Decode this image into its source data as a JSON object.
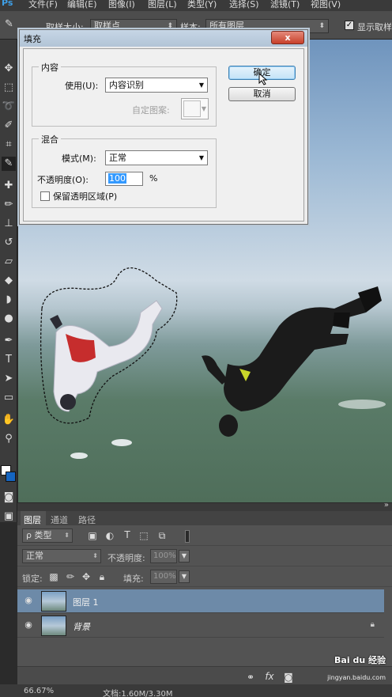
{
  "menu": [
    "文件(F)",
    "编辑(E)",
    "图像(I)",
    "图层(L)",
    "类型(Y)",
    "选择(S)",
    "滤镜(T)",
    "视图(V)"
  ],
  "options_bar": {
    "sample_size_label": "取样大小:",
    "sample_size_value": "取样点",
    "sample_label": "样本:",
    "sample_value": "所有图层",
    "show_ring_label": "显示取样"
  },
  "dialog": {
    "title": "填充",
    "close_label": "x",
    "content_group": "内容",
    "use_label": "使用(U):",
    "use_value": "内容识别",
    "custom_pattern_label": "自定图案:",
    "blend_group": "混合",
    "mode_label": "模式(M):",
    "mode_value": "正常",
    "opacity_label": "不透明度(O):",
    "opacity_value": "100",
    "opacity_unit": "%",
    "preserve_label": "保留透明区域(P)",
    "ok_label": "确定",
    "cancel_label": "取消"
  },
  "layers_panel": {
    "tabs": [
      "图层",
      "通道",
      "路径"
    ],
    "filter_value": "ρ 类型",
    "blend_value": "正常",
    "opacity_label": "不透明度:",
    "opacity_value": "100%",
    "lock_label": "锁定:",
    "fill_label": "填充:",
    "fill_value": "100%",
    "layers": [
      {
        "name": "图层 1",
        "selected": true
      },
      {
        "name": "背景",
        "selected": false,
        "locked": true
      }
    ],
    "bottom_icons": [
      "link-icon",
      "fx-icon",
      "mask-icon"
    ]
  },
  "status": {
    "zoom": "66.67%",
    "doc": "文档:1.60M/3.30M"
  },
  "watermark": {
    "text": "Bai du 经验",
    "url": "jingyan.baidu.com"
  }
}
